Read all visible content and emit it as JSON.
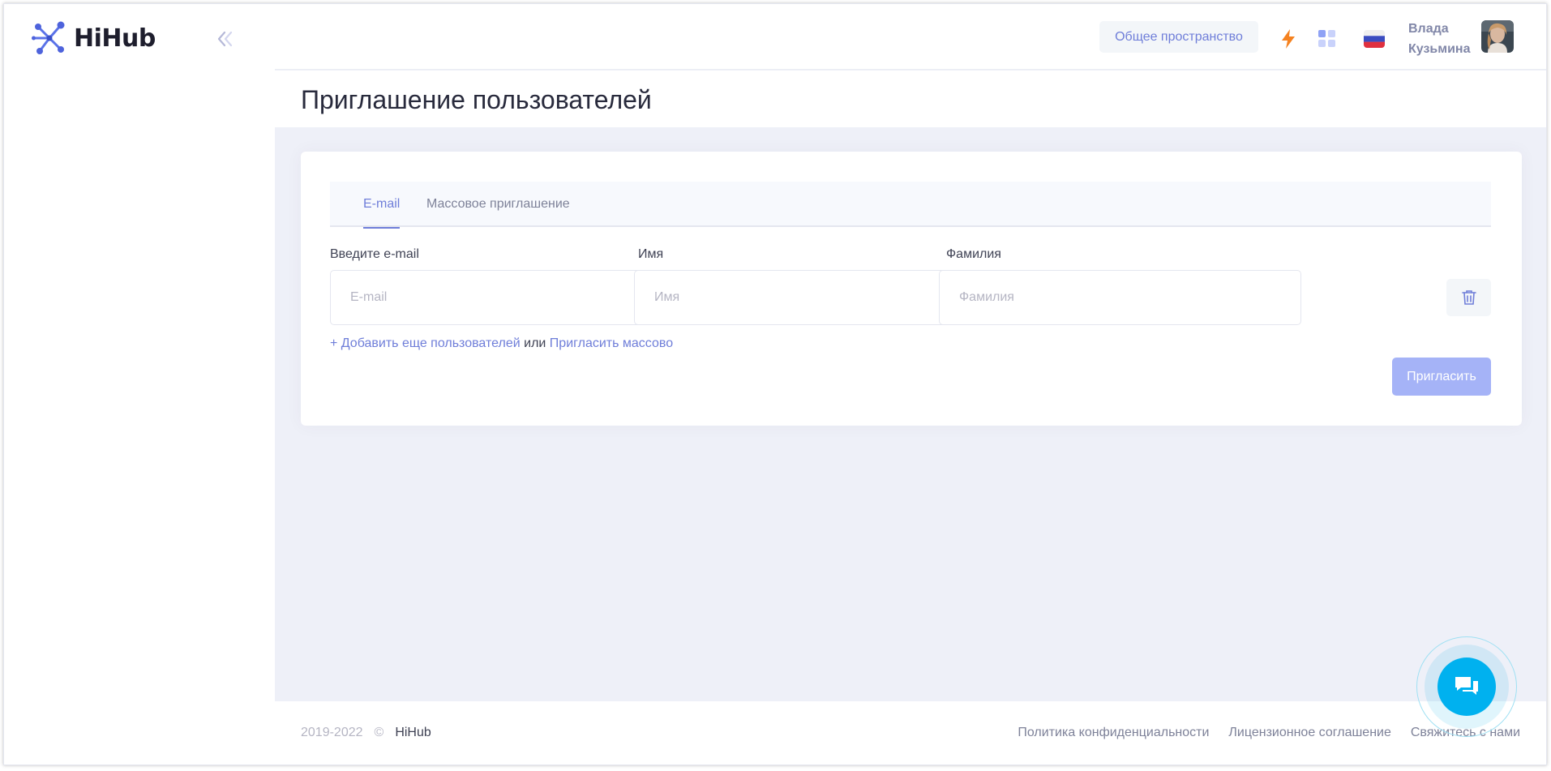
{
  "brand": {
    "name": "HiHub"
  },
  "header": {
    "workspace_label": "Общее пространство",
    "user_first": "Влада",
    "user_last": "Кузьмина"
  },
  "page": {
    "title": "Приглашение пользователей"
  },
  "tabs": [
    {
      "label": "E-mail",
      "active": true
    },
    {
      "label": "Массовое приглашение",
      "active": false
    }
  ],
  "form": {
    "email": {
      "label": "Введите e-mail",
      "placeholder": "E-mail",
      "value": ""
    },
    "first_name": {
      "label": "Имя",
      "placeholder": "Имя",
      "value": ""
    },
    "last_name": {
      "label": "Фамилия",
      "placeholder": "Фамилия",
      "value": ""
    },
    "add_more_link": "+ Добавить еще пользователей",
    "or_text": "или",
    "bulk_link": "Пригласить массово",
    "submit_label": "Пригласить"
  },
  "footer": {
    "years": "2019-2022",
    "copyright": "©",
    "brand": "HiHub",
    "links": [
      "Политика конфиденциальности",
      "Лицензионное соглашение",
      "Свяжитесь с нами"
    ]
  },
  "icons": {
    "logo": "network-logo-icon",
    "collapse": "double-chevron-left-icon",
    "lightning": "lightning-icon",
    "apps": "apps-grid-icon",
    "flag": "russia-flag-icon",
    "trash": "trash-icon",
    "chat": "chat-icon"
  },
  "colors": {
    "accent": "#6f7ed9",
    "button_disabled": "#a5b3f7",
    "chat": "#00b1ef",
    "lightning": "#f58220",
    "background": "#eef0f8"
  }
}
